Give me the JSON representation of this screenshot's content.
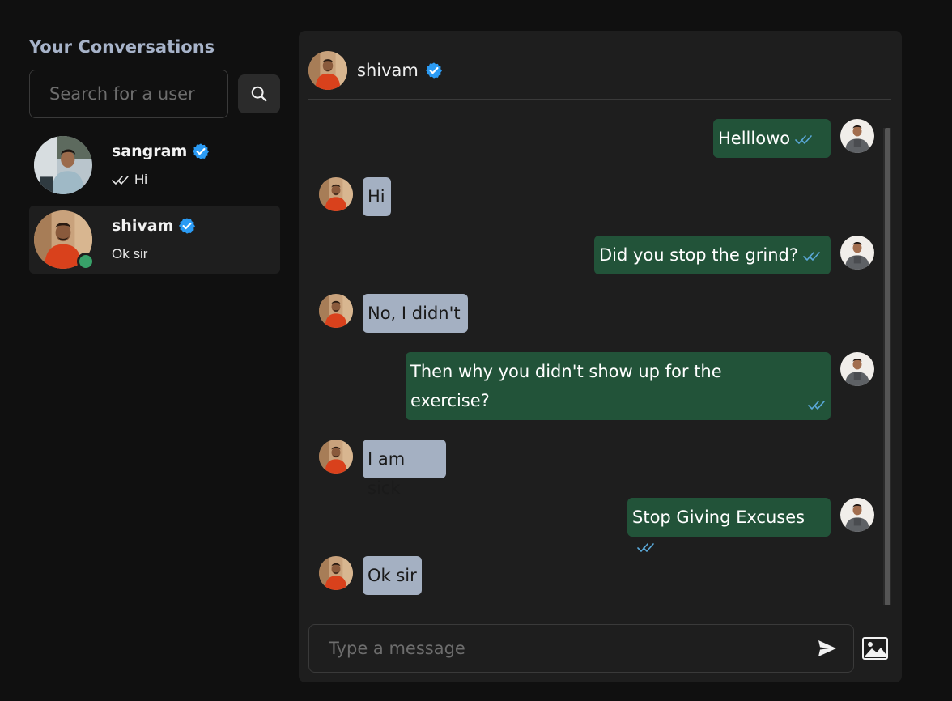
{
  "sidebar": {
    "heading": "Your Conversations",
    "search": {
      "placeholder": "Search for a user",
      "value": ""
    },
    "conversations": [
      {
        "name": "sangram",
        "verified": true,
        "last_message": "Hi",
        "read_ticks": true,
        "online": false,
        "selected": false
      },
      {
        "name": "shivam",
        "verified": true,
        "last_message": "Ok sir",
        "read_ticks": false,
        "online": true,
        "selected": true
      }
    ]
  },
  "chat": {
    "contact_name": "shivam",
    "verified": true,
    "messages": [
      {
        "from": "me",
        "text": "Helllowo"
      },
      {
        "from": "them",
        "text": "Hi"
      },
      {
        "from": "me",
        "text": "Did you stop the grind?"
      },
      {
        "from": "them",
        "text": "No, I didn't"
      },
      {
        "from": "me",
        "text": "Then why you didn't show up for the exercise?"
      },
      {
        "from": "them",
        "text": "I am sick"
      },
      {
        "from": "me",
        "text": "Stop Giving Excuses"
      },
      {
        "from": "them",
        "text": "Ok sir"
      }
    ],
    "composer": {
      "placeholder": "Type a message",
      "value": ""
    }
  },
  "colors": {
    "background": "#101010",
    "panel": "#1e1e1e",
    "outgoing_bubble": "#225339",
    "incoming_bubble": "#a4b0c2",
    "verified_badge": "#2b9bf4",
    "online_dot": "#38a169",
    "heading": "#a7b3c9",
    "read_ticks": "#5aa8d8"
  },
  "icons": {
    "search": "search-icon",
    "verified": "verified-badge-icon",
    "read_receipt": "double-check-icon",
    "send": "send-icon",
    "image": "image-icon"
  }
}
